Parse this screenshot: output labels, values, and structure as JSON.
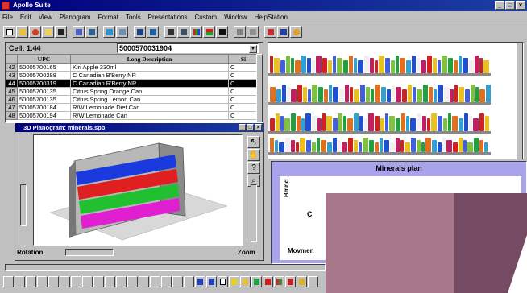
{
  "app": {
    "title": "Apollo Suite"
  },
  "menu": [
    "File",
    "Edit",
    "View",
    "Planogram",
    "Format",
    "Tools",
    "Presentations",
    "Custom",
    "Window",
    "HelpStation"
  ],
  "cell_bar": {
    "label": "Cell: 1.44",
    "value": "5000570031904"
  },
  "table": {
    "headers": [
      "UPC",
      "Long Description",
      "Si"
    ],
    "rows": [
      {
        "n": "42",
        "upc": "50005700165",
        "desc": "Kiri Apple 330ml",
        "si": "C"
      },
      {
        "n": "43",
        "upc": "50005700288",
        "desc": "C Canadian B'Berry NR",
        "si": "C"
      },
      {
        "n": "44",
        "upc": "50005700319",
        "desc": "C Canadian R'Berry NR",
        "si": "C",
        "selected": true
      },
      {
        "n": "45",
        "upc": "50005700135",
        "desc": "Citrus Spring Orange Can",
        "si": "C"
      },
      {
        "n": "46",
        "upc": "50005700135",
        "desc": "Citrus Spring Lemon Can",
        "si": "C"
      },
      {
        "n": "47",
        "upc": "50005700184",
        "desc": "R/W Lemonade Diet Can",
        "si": "C"
      },
      {
        "n": "48",
        "upc": "50005700194",
        "desc": "R/W Lemonade Can",
        "si": "C"
      }
    ]
  },
  "win3d": {
    "title": "3D Planogram: minerals.spb",
    "rotation_label": "Rotation",
    "zoom_label": "Zoom"
  },
  "plan": {
    "title": "Minerals plan",
    "axis_label": "Bmnd",
    "letter": "C",
    "bottom_label": "Movmen"
  },
  "colors": {
    "titlebar": "#00007b",
    "plan_bg": "#a9a3ec",
    "swatch_light": "#a8788a",
    "swatch_dark": "#754a63"
  }
}
